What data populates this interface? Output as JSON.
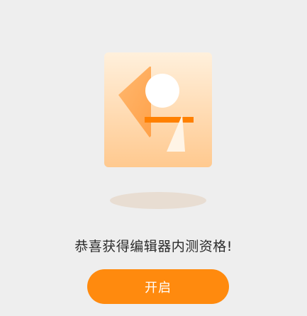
{
  "dialog": {
    "message": "恭喜获得编辑器内测资格!",
    "open_button_label": "开启"
  },
  "colors": {
    "background": "#eeeeee",
    "accent": "#ff8a0e",
    "card_gradient_top": "#fff0dc",
    "card_gradient_bottom": "#ffc98f",
    "message_text": "#2b2b2b"
  },
  "icons": {
    "illustration": "editor-shapes-illustration"
  }
}
